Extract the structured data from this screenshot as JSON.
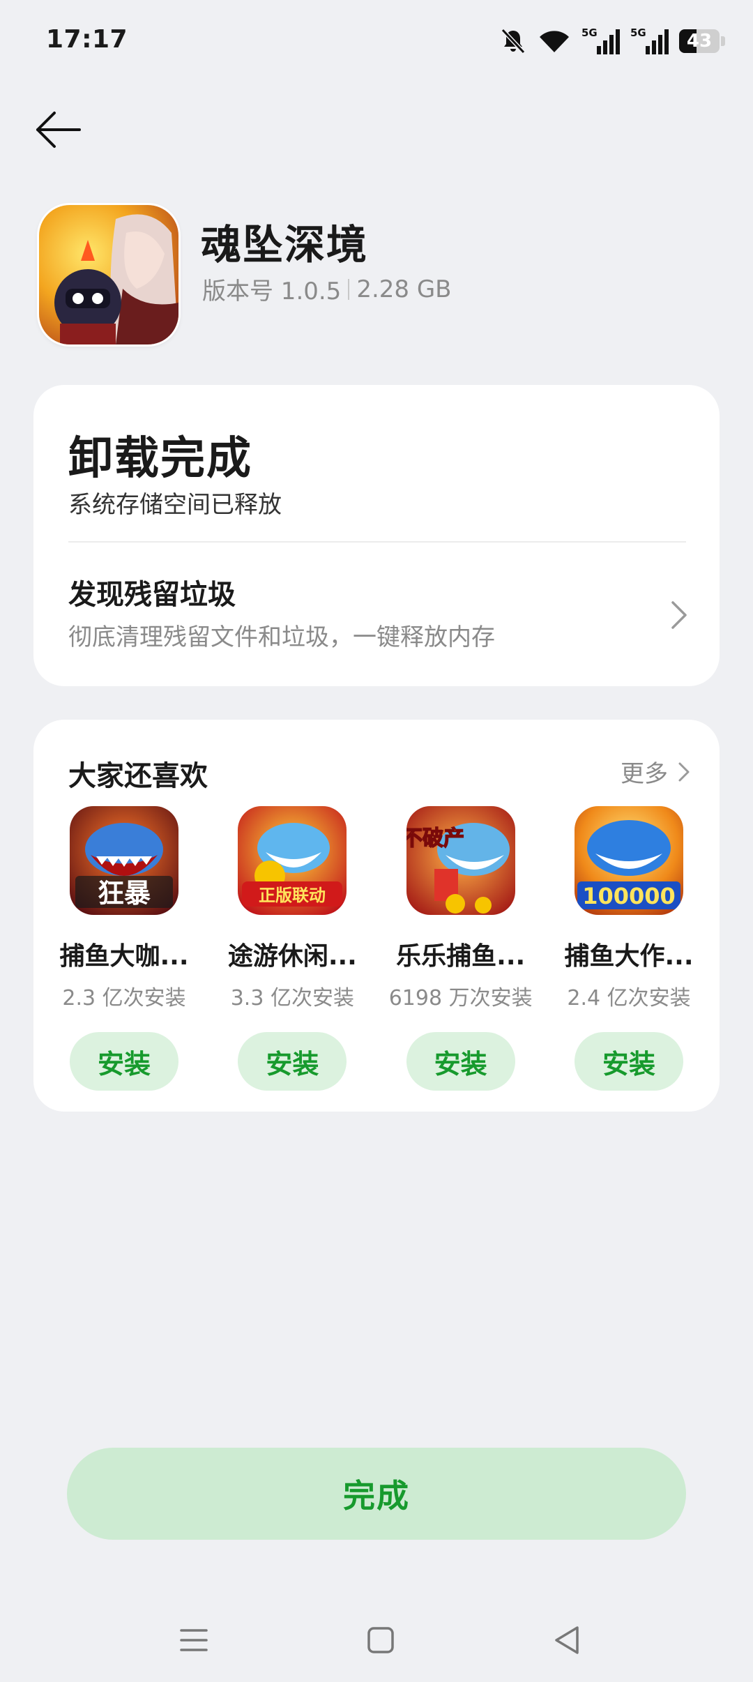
{
  "status": {
    "time": "17:17",
    "battery": "43",
    "battery_level": 0.43,
    "signal_1_label": "5G",
    "signal_2_label": "5G",
    "icons": [
      "mute-bell-icon",
      "wifi-icon",
      "signal-5g-icon",
      "signal-5g-icon",
      "battery-icon"
    ]
  },
  "header": {
    "app_name": "魂坠深境",
    "version": "版本号 1.0.5",
    "size": "2.28 GB"
  },
  "uninstall": {
    "title": "卸载完成",
    "subtitle": "系统存储空间已释放",
    "residual_title": "发现残留垃圾",
    "residual_sub": "彻底清理残留文件和垃圾，一键释放内存"
  },
  "recommend": {
    "title": "大家还喜欢",
    "more": "更多",
    "items": [
      {
        "name": "捕鱼大咖...",
        "installs": "2.3 亿次安装",
        "button": "安装",
        "icon_text": "狂暴"
      },
      {
        "name": "途游休闲...",
        "installs": "3.3 亿次安装",
        "button": "安装",
        "icon_text": "正版联动"
      },
      {
        "name": "乐乐捕鱼...",
        "installs": "6198 万次安装",
        "button": "安装",
        "icon_text": "不破产"
      },
      {
        "name": "捕鱼大作...",
        "installs": "2.4 亿次安装",
        "button": "安装",
        "icon_text": "100000"
      }
    ]
  },
  "done_button": "完成",
  "colors": {
    "accent_green": "#179a2d",
    "button_bg": "#dcf2df",
    "done_bg": "#cdebd2",
    "page_bg": "#eff0f3"
  }
}
